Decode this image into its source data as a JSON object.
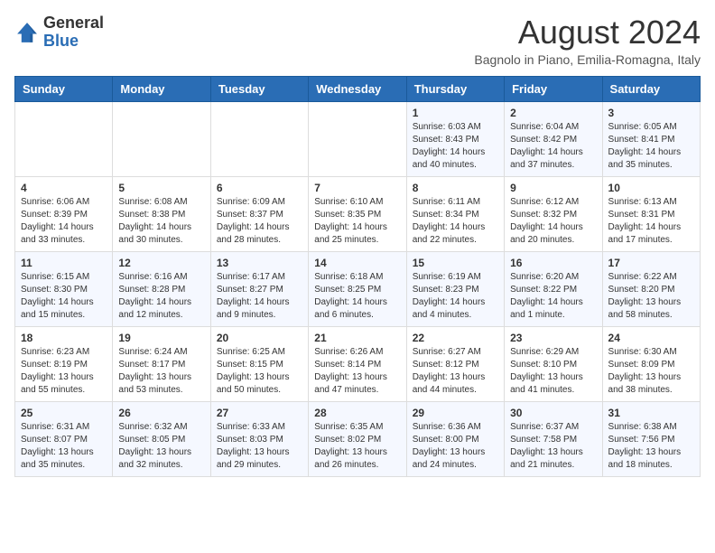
{
  "logo": {
    "general": "General",
    "blue": "Blue"
  },
  "header": {
    "title": "August 2024",
    "subtitle": "Bagnolo in Piano, Emilia-Romagna, Italy"
  },
  "days": [
    "Sunday",
    "Monday",
    "Tuesday",
    "Wednesday",
    "Thursday",
    "Friday",
    "Saturday"
  ],
  "weeks": [
    [
      {
        "day": "",
        "text": ""
      },
      {
        "day": "",
        "text": ""
      },
      {
        "day": "",
        "text": ""
      },
      {
        "day": "",
        "text": ""
      },
      {
        "day": "1",
        "text": "Sunrise: 6:03 AM\nSunset: 8:43 PM\nDaylight: 14 hours\nand 40 minutes."
      },
      {
        "day": "2",
        "text": "Sunrise: 6:04 AM\nSunset: 8:42 PM\nDaylight: 14 hours\nand 37 minutes."
      },
      {
        "day": "3",
        "text": "Sunrise: 6:05 AM\nSunset: 8:41 PM\nDaylight: 14 hours\nand 35 minutes."
      }
    ],
    [
      {
        "day": "4",
        "text": "Sunrise: 6:06 AM\nSunset: 8:39 PM\nDaylight: 14 hours\nand 33 minutes."
      },
      {
        "day": "5",
        "text": "Sunrise: 6:08 AM\nSunset: 8:38 PM\nDaylight: 14 hours\nand 30 minutes."
      },
      {
        "day": "6",
        "text": "Sunrise: 6:09 AM\nSunset: 8:37 PM\nDaylight: 14 hours\nand 28 minutes."
      },
      {
        "day": "7",
        "text": "Sunrise: 6:10 AM\nSunset: 8:35 PM\nDaylight: 14 hours\nand 25 minutes."
      },
      {
        "day": "8",
        "text": "Sunrise: 6:11 AM\nSunset: 8:34 PM\nDaylight: 14 hours\nand 22 minutes."
      },
      {
        "day": "9",
        "text": "Sunrise: 6:12 AM\nSunset: 8:32 PM\nDaylight: 14 hours\nand 20 minutes."
      },
      {
        "day": "10",
        "text": "Sunrise: 6:13 AM\nSunset: 8:31 PM\nDaylight: 14 hours\nand 17 minutes."
      }
    ],
    [
      {
        "day": "11",
        "text": "Sunrise: 6:15 AM\nSunset: 8:30 PM\nDaylight: 14 hours\nand 15 minutes."
      },
      {
        "day": "12",
        "text": "Sunrise: 6:16 AM\nSunset: 8:28 PM\nDaylight: 14 hours\nand 12 minutes."
      },
      {
        "day": "13",
        "text": "Sunrise: 6:17 AM\nSunset: 8:27 PM\nDaylight: 14 hours\nand 9 minutes."
      },
      {
        "day": "14",
        "text": "Sunrise: 6:18 AM\nSunset: 8:25 PM\nDaylight: 14 hours\nand 6 minutes."
      },
      {
        "day": "15",
        "text": "Sunrise: 6:19 AM\nSunset: 8:23 PM\nDaylight: 14 hours\nand 4 minutes."
      },
      {
        "day": "16",
        "text": "Sunrise: 6:20 AM\nSunset: 8:22 PM\nDaylight: 14 hours\nand 1 minute."
      },
      {
        "day": "17",
        "text": "Sunrise: 6:22 AM\nSunset: 8:20 PM\nDaylight: 13 hours\nand 58 minutes."
      }
    ],
    [
      {
        "day": "18",
        "text": "Sunrise: 6:23 AM\nSunset: 8:19 PM\nDaylight: 13 hours\nand 55 minutes."
      },
      {
        "day": "19",
        "text": "Sunrise: 6:24 AM\nSunset: 8:17 PM\nDaylight: 13 hours\nand 53 minutes."
      },
      {
        "day": "20",
        "text": "Sunrise: 6:25 AM\nSunset: 8:15 PM\nDaylight: 13 hours\nand 50 minutes."
      },
      {
        "day": "21",
        "text": "Sunrise: 6:26 AM\nSunset: 8:14 PM\nDaylight: 13 hours\nand 47 minutes."
      },
      {
        "day": "22",
        "text": "Sunrise: 6:27 AM\nSunset: 8:12 PM\nDaylight: 13 hours\nand 44 minutes."
      },
      {
        "day": "23",
        "text": "Sunrise: 6:29 AM\nSunset: 8:10 PM\nDaylight: 13 hours\nand 41 minutes."
      },
      {
        "day": "24",
        "text": "Sunrise: 6:30 AM\nSunset: 8:09 PM\nDaylight: 13 hours\nand 38 minutes."
      }
    ],
    [
      {
        "day": "25",
        "text": "Sunrise: 6:31 AM\nSunset: 8:07 PM\nDaylight: 13 hours\nand 35 minutes."
      },
      {
        "day": "26",
        "text": "Sunrise: 6:32 AM\nSunset: 8:05 PM\nDaylight: 13 hours\nand 32 minutes."
      },
      {
        "day": "27",
        "text": "Sunrise: 6:33 AM\nSunset: 8:03 PM\nDaylight: 13 hours\nand 29 minutes."
      },
      {
        "day": "28",
        "text": "Sunrise: 6:35 AM\nSunset: 8:02 PM\nDaylight: 13 hours\nand 26 minutes."
      },
      {
        "day": "29",
        "text": "Sunrise: 6:36 AM\nSunset: 8:00 PM\nDaylight: 13 hours\nand 24 minutes."
      },
      {
        "day": "30",
        "text": "Sunrise: 6:37 AM\nSunset: 7:58 PM\nDaylight: 13 hours\nand 21 minutes."
      },
      {
        "day": "31",
        "text": "Sunrise: 6:38 AM\nSunset: 7:56 PM\nDaylight: 13 hours\nand 18 minutes."
      }
    ]
  ]
}
